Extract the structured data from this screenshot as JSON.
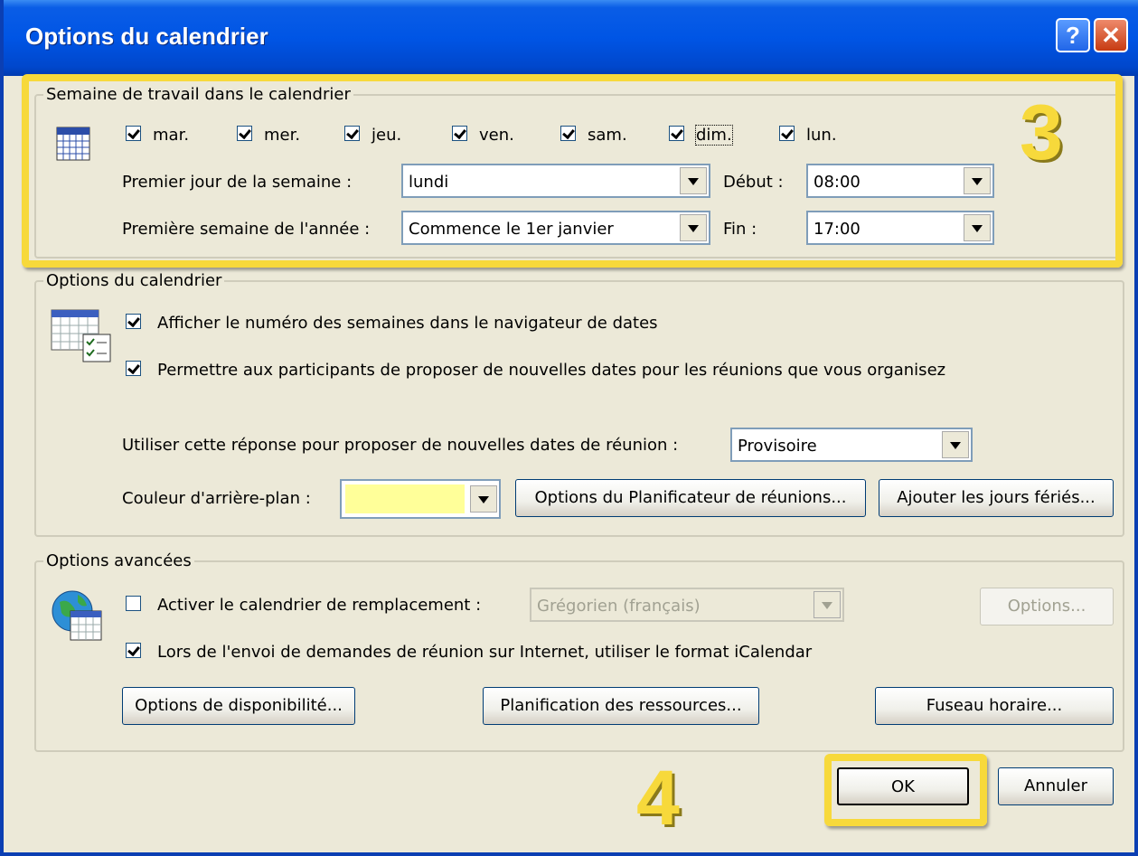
{
  "window": {
    "title": "Options du calendrier",
    "help_glyph": "?",
    "close_glyph": "✕"
  },
  "work_week": {
    "legend": "Semaine de travail dans le calendrier",
    "days": [
      {
        "label": "mar.",
        "checked": true
      },
      {
        "label": "mer.",
        "checked": true
      },
      {
        "label": "jeu.",
        "checked": true
      },
      {
        "label": "ven.",
        "checked": true
      },
      {
        "label": "sam.",
        "checked": true
      },
      {
        "label": "dim.",
        "checked": true
      },
      {
        "label": "lun.",
        "checked": true
      }
    ],
    "first_day_label": "Premier jour de la semaine :",
    "first_day_value": "lundi",
    "first_week_label": "Première semaine de l'année :",
    "first_week_value": "Commence le 1er janvier",
    "start_label": "Début :",
    "start_value": "08:00",
    "end_label": "Fin :",
    "end_value": "17:00"
  },
  "calendar_options": {
    "legend": "Options du calendrier",
    "show_week_numbers": "Afficher le numéro des semaines dans le navigateur de dates",
    "allow_propose": "Permettre aux participants de proposer de nouvelles dates pour les réunions que vous organisez",
    "response_label": "Utiliser cette réponse pour proposer de nouvelles dates de réunion :",
    "response_value": "Provisoire",
    "bg_color_label": "Couleur d'arrière-plan :",
    "bg_color": "#ffff99",
    "scheduler_button": "Options du Planificateur de réunions...",
    "holidays_button": "Ajouter les jours fériés..."
  },
  "advanced": {
    "legend": "Options avancées",
    "alt_calendar_label": "Activer le calendrier de remplacement :",
    "alt_calendar_value": "Grégorien (français)",
    "options_button": "Options...",
    "icalendar_label": "Lors de l'envoi de demandes de réunion sur Internet, utiliser le format iCalendar",
    "availability_button": "Options de disponibilité...",
    "resources_button": "Planification des ressources...",
    "timezone_button": "Fuseau horaire..."
  },
  "footer": {
    "ok": "OK",
    "cancel": "Annuler"
  },
  "annotations": {
    "step3": "3",
    "step4": "4",
    "highlight_color": "#f7d93b"
  }
}
